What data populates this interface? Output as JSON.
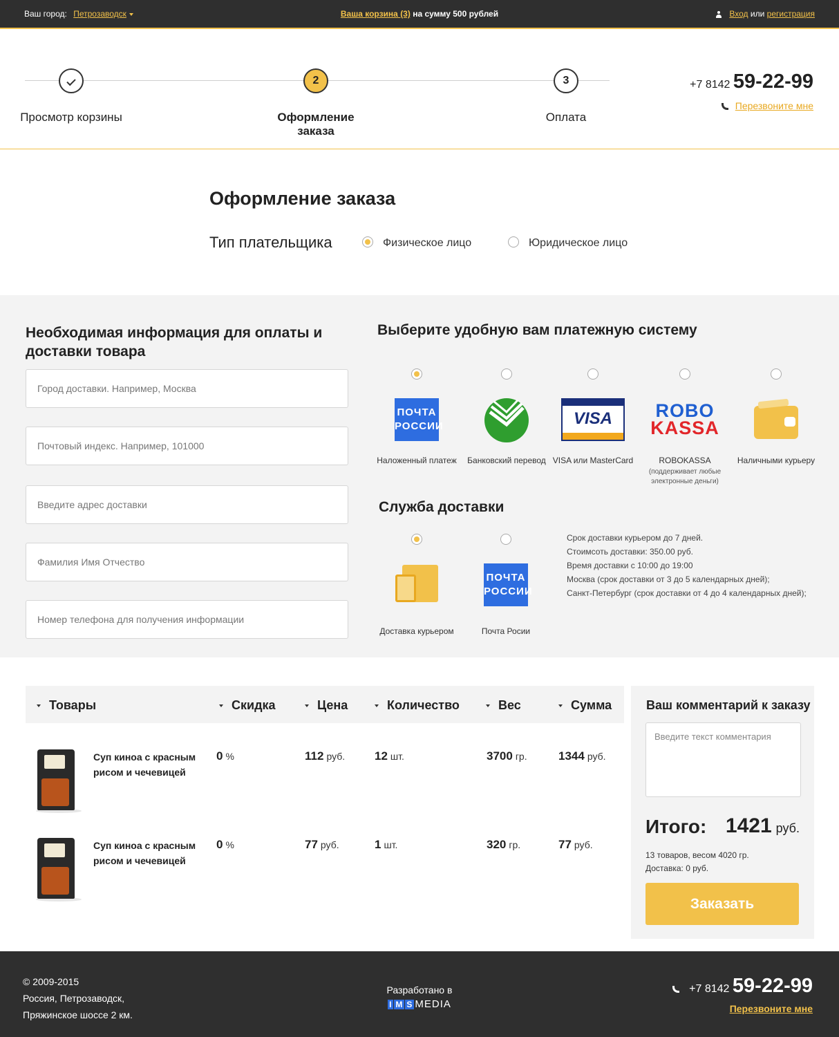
{
  "topbar": {
    "city_label": "Ваш город:",
    "city_value": "Петрозаводск",
    "cart_link": "Ваша корзина (3)",
    "cart_sum": "на сумму 500 рублей",
    "login": "Вход",
    "or": "или",
    "register": "регистрация"
  },
  "steps": [
    {
      "number": "",
      "label": "Просмотр корзины",
      "state": "done"
    },
    {
      "number": "2",
      "label": "Оформление заказа",
      "state": "active"
    },
    {
      "number": "3",
      "label": "Оплата",
      "state": "pending"
    }
  ],
  "phone": {
    "prefix": "+7 8142",
    "number": "59-22-99",
    "callback": "Перезвоните мне"
  },
  "order": {
    "title": "Оформление заказа",
    "payer_label": "Тип плательщика",
    "payer_options": [
      {
        "label": "Физическое лицо",
        "selected": true
      },
      {
        "label": "Юридическое лицо",
        "selected": false
      }
    ]
  },
  "info": {
    "title": "Необходимая информация для оплаты и доставки товара",
    "fields": [
      {
        "placeholder": "Город доставки. Например, Москва"
      },
      {
        "placeholder": "Почтовый индекс. Например, 101000"
      },
      {
        "placeholder": "Введите адрес доставки"
      },
      {
        "placeholder": "Фамилия Имя Отчество"
      },
      {
        "placeholder": "Номер телефона для получения информации"
      }
    ]
  },
  "payment": {
    "title": "Выберите удобную вам платежную систему",
    "options": [
      {
        "label": "Наложенный платеж",
        "logo_text_1": "ПОЧТА",
        "logo_text_2": "РОССИИ",
        "selected": true
      },
      {
        "label": "Банковский перевод",
        "selected": false
      },
      {
        "label": "VISA или MasterCard",
        "logo_text": "VISA",
        "selected": false
      },
      {
        "label": "ROBOKASSA",
        "sub": "(поддерживает любые электронные деньги)",
        "logo_text_1": "ROBO",
        "logo_text_2": "KASSA",
        "selected": false
      },
      {
        "label": "Наличными курьеру",
        "selected": false
      }
    ]
  },
  "delivery": {
    "title": "Служба доставки",
    "options": [
      {
        "label": "Доставка курьером",
        "selected": true
      },
      {
        "label": "Почта Росии",
        "logo_text_1": "ПОЧТА",
        "logo_text_2": "РОССИИ",
        "selected": false
      }
    ],
    "info": [
      "Срок доставки курьером до 7 дней.",
      "Стоимсоть доставки: 350.00 руб.",
      "Время доставки с 10:00 до 19:00",
      "Москва (срок доставки от 3 до 5 календарных дней);",
      "Санкт-Петербург (срок доставки от 4 до 4 календарных дней);"
    ]
  },
  "table": {
    "headers": [
      "Товары",
      "Скидка",
      "Цена",
      "Количество",
      "Вес",
      "Сумма"
    ],
    "rows": [
      {
        "name": "Суп киноа с красным рисом и чечевицей",
        "discount": "0",
        "discount_unit": "%",
        "price": "112",
        "price_unit": "руб.",
        "qty": "12",
        "qty_unit": "шт.",
        "weight": "3700",
        "weight_unit": "гр.",
        "sum": "1344",
        "sum_unit": "руб."
      },
      {
        "name": "Суп киноа с красным рисом и чечевицей",
        "discount": "0",
        "discount_unit": "%",
        "price": "77",
        "price_unit": "руб.",
        "qty": "1",
        "qty_unit": "шт.",
        "weight": "320",
        "weight_unit": "гр.",
        "sum": "77",
        "sum_unit": "руб."
      }
    ]
  },
  "comment": {
    "title": "Ваш комментарий к заказу",
    "placeholder": "Введите текст комментария",
    "total_label": "Итого:",
    "total_value": "1421",
    "total_unit": "руб.",
    "summary_1": "13 товаров, весом 4020 гр.",
    "summary_2": "Доставка: 0 руб.",
    "button": "Заказать"
  },
  "footer": {
    "copyright": "© 2009-2015",
    "address_1": "Россия, Петрозаводск,",
    "address_2": "Пряжинское шоссе 2 км.",
    "dev_label": "Разработано в",
    "dev_brand_letters": [
      "I",
      "M",
      "S"
    ],
    "dev_brand_rest": "MEDIA",
    "phone_prefix": "+7 8142",
    "phone_number": "59-22-99",
    "callback": "Перезвоните мне"
  },
  "colors": {
    "accent": "#f2c14a",
    "dark": "#2f2f2f",
    "gray_bg": "#f3f3f3",
    "pochta_blue": "#2e6de0"
  }
}
